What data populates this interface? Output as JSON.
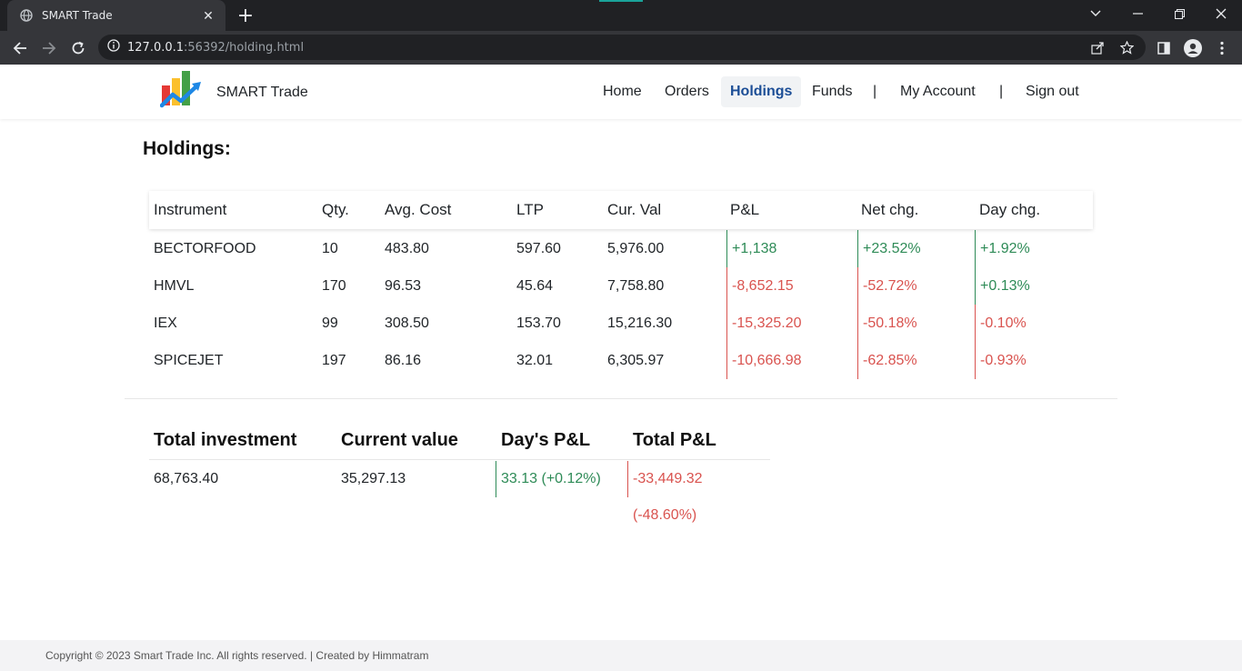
{
  "browser": {
    "tab_title": "SMART Trade",
    "url_host": "127.0.0.1",
    "url_rest": ":56392/holding.html"
  },
  "navbar": {
    "brand": "SMART Trade",
    "links": [
      "Home",
      "Orders",
      "Holdings",
      "Funds",
      "My Account",
      "Sign out"
    ],
    "active": "Holdings",
    "separator": "|"
  },
  "page_title": "Holdings:",
  "holdings": {
    "headers": [
      "Instrument",
      "Qty.",
      "Avg. Cost",
      "LTP",
      "Cur. Val",
      "P&L",
      "Net chg.",
      "Day chg."
    ],
    "rows": [
      {
        "instrument": "BECTORFOOD",
        "qty": "10",
        "avg_cost": "483.80",
        "ltp": "597.60",
        "cur_val": "5,976.00",
        "pnl": "+1,138",
        "net_chg": "+23.52%",
        "day_chg": "+1.92%"
      },
      {
        "instrument": "HMVL",
        "qty": "170",
        "avg_cost": "96.53",
        "ltp": "45.64",
        "cur_val": "7,758.80",
        "pnl": "-8,652.15",
        "net_chg": "-52.72%",
        "day_chg": "+0.13%"
      },
      {
        "instrument": "IEX",
        "qty": "99",
        "avg_cost": "308.50",
        "ltp": "153.70",
        "cur_val": "15,216.30",
        "pnl": "-15,325.20",
        "net_chg": "-50.18%",
        "day_chg": "-0.10%"
      },
      {
        "instrument": "SPICEJET",
        "qty": "197",
        "avg_cost": "86.16",
        "ltp": "32.01",
        "cur_val": "6,305.97",
        "pnl": "-10,666.98",
        "net_chg": "-62.85%",
        "day_chg": "-0.93%"
      }
    ]
  },
  "summary": {
    "headers": [
      "Total investment",
      "Current value",
      "Day's P&L",
      "Total P&L"
    ],
    "total_investment": "68,763.40",
    "current_value": "35,297.13",
    "day_pnl": "33.13 (+0.12%)",
    "total_pnl": "-33,449.32 (-48.60%)"
  },
  "footer": {
    "text": "Copyright © 2023 Smart Trade Inc. All rights reserved. | Created by Himmatram"
  },
  "colors": {
    "positive": "#2e8b57",
    "negative": "#d9534f",
    "active_link": "#1c4e96"
  }
}
